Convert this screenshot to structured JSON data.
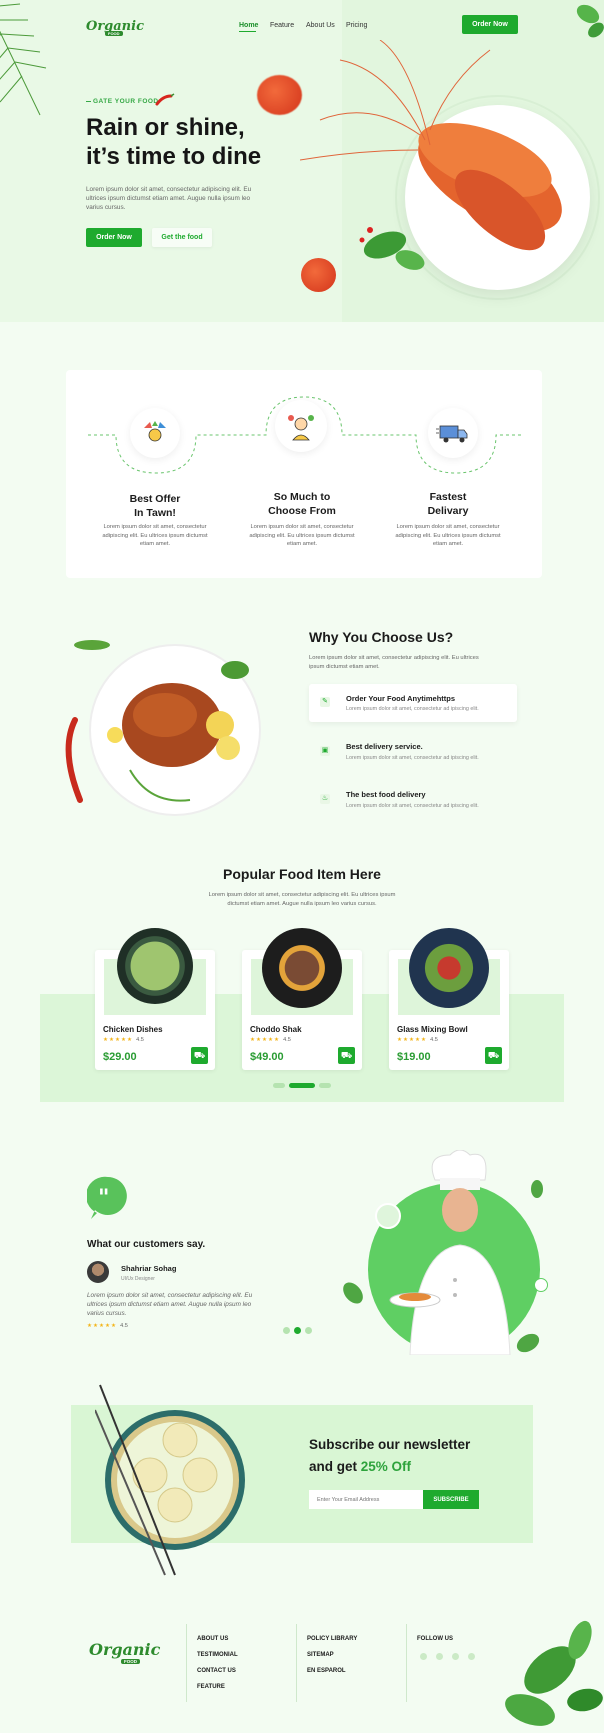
{
  "brand": {
    "logo_main": "Organic",
    "logo_sub": "FOOD",
    "accent": "#1eaa2e",
    "light_green": "#e9f9e6"
  },
  "nav": {
    "items": [
      "Home",
      "Feature",
      "About Us",
      "Pricing"
    ],
    "cta": "Order Now"
  },
  "hero": {
    "tag": "GATE YOUR FOOD",
    "title_line1": "Rain or shine,",
    "title_line2": "it’s time to dine",
    "body": "Lorem ipsum dolor sit amet, consectetur adipiscing elit. Eu ultrices ipsum dictumst etiam amet. Augue nulla ipsum leo varius cursus.",
    "btn_primary": "Order Now",
    "btn_secondary": "Get the food"
  },
  "features": [
    {
      "title_line1": "Best Offer",
      "title_line2": "In Tawn!",
      "body": "Lorem ipsum dolor sit amet, consectetur adipiscing elit. Eu ultrices ipsum dictumst etiam amet.",
      "icon": "offer-icon"
    },
    {
      "title_line1": "So Much to",
      "title_line2": "Choose From",
      "body": "Lorem ipsum dolor sit amet, consectetur adipiscing elit. Eu ultrices ipsum dictumst etiam amet.",
      "icon": "choose-icon"
    },
    {
      "title_line1": "Fastest",
      "title_line2": "Delivary",
      "body": "Lorem ipsum dolor sit amet, consectetur adipiscing elit. Eu ultrices ipsum dictumst etiam amet.",
      "icon": "delivery-truck-icon"
    }
  ],
  "why": {
    "title": "Why You Choose Us?",
    "body": "Lorem ipsum dolor sit amet, consectetur adipiscing elit. Eu ultrices ipsum dictumst etiam amet.",
    "items": [
      {
        "title": "Order Your Food Anytimehttps",
        "body": "Lorem ipsum dolor sit amet, consectetur ad ipiscing elit."
      },
      {
        "title": "Best delivery service.",
        "body": "Lorem ipsum dolor sit amet, consectetur ad ipiscing elit."
      },
      {
        "title": "The best food delivery",
        "body": "Lorem ipsum dolor sit amet, consectetur ad ipiscing elit."
      }
    ]
  },
  "popular": {
    "title": "Popular Food Item Here",
    "body": "Lorem ipsum dolor sit amet, consectetur adipiscing elit. Eu ultrices ipsum dictumst etiam amet. Augue nulla ipsum leo varius cursus.",
    "items": [
      {
        "name": "Chicken Dishes",
        "rating": "4.5",
        "price": "$29.00"
      },
      {
        "name": "Choddo Shak",
        "rating": "4.5",
        "price": "$49.00"
      },
      {
        "name": "Glass Mixing Bowl",
        "rating": "4.5",
        "price": "$19.00"
      }
    ],
    "stars": "★★★★★",
    "carousel_active": 1
  },
  "testimonial": {
    "title": "What our customers say.",
    "name": "Shahriar Sohag",
    "role": "UI/Ux Designer",
    "quote": "Lorem ipsum dolor sit amet, consectetur adipiscing elit. Eu ultrices ipsum dictumst etiam amet. Augue nulla ipsum leo varius cursus.",
    "stars": "★★★★★",
    "rating": "4.5"
  },
  "newsletter": {
    "title_line1": "Subscribe our newsletter",
    "title_line2_prefix": "and get",
    "title_highlight": "25% Off",
    "placeholder": "Enter Your Email Address",
    "button": "SUBSCRIBE"
  },
  "footer": {
    "col1": [
      "ABOUT US",
      "TESTIMONIAL",
      "CONTACT US",
      "FEATURE"
    ],
    "col2": [
      "POLICY LIBRARY",
      "SITEMAP",
      "EN ESPAROL"
    ],
    "follow": "FOLLOW US",
    "socials": [
      "facebook-icon",
      "twitter-icon",
      "instagram-icon",
      "linkedin-icon"
    ]
  }
}
